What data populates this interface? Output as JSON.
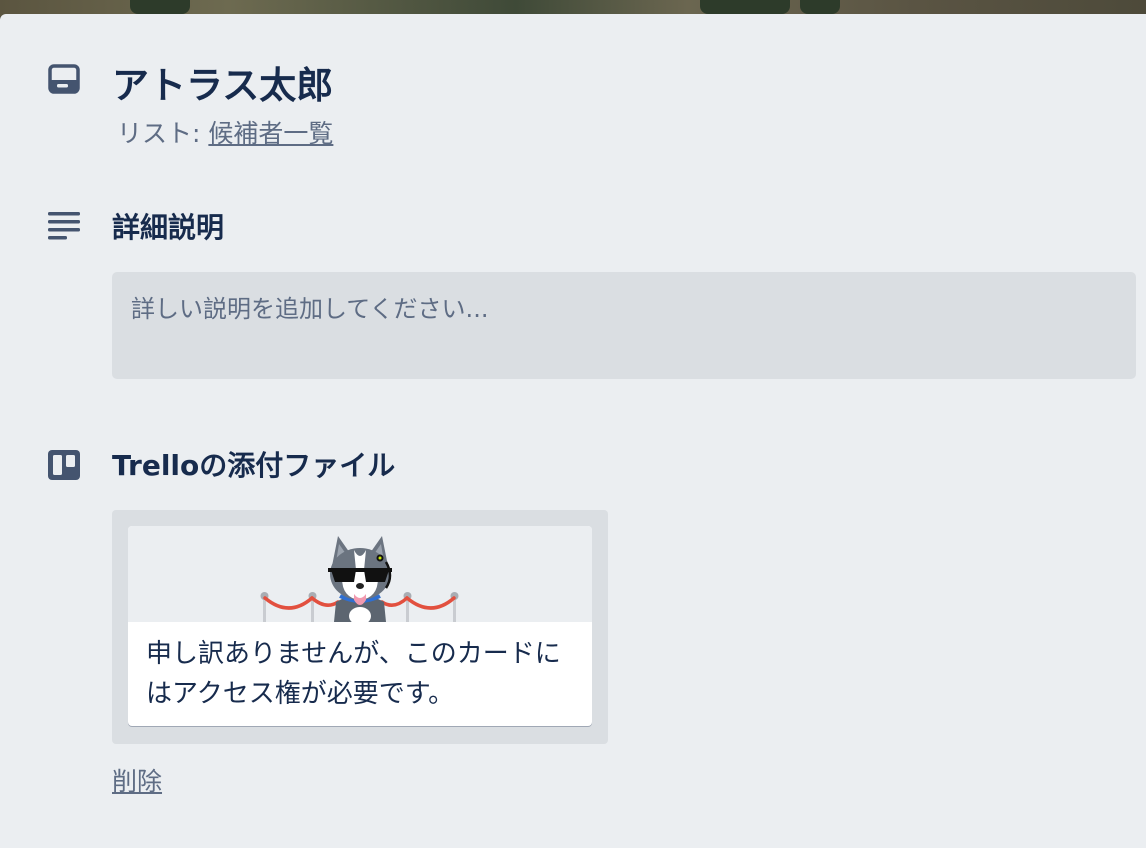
{
  "card": {
    "title": "アトラス太郎",
    "list_prefix": "リスト: ",
    "list_name": "候補者一覧"
  },
  "description": {
    "heading": "詳細説明",
    "placeholder": "詳しい説明を追加してください..."
  },
  "attachments": {
    "heading": "Trelloの添付ファイル",
    "card_message": "申し訳ありませんが、このカードにはアクセス権が必要です。",
    "delete_label": "削除"
  },
  "icons": {
    "card": "card-icon",
    "description": "description-lines-icon",
    "trello": "trello-board-icon",
    "mascot": "husky-mascot-with-sunglasses"
  },
  "colors": {
    "panel_bg": "#ebeef1",
    "box_bg": "#dadee2",
    "heading_text": "#172b4d",
    "muted_text": "#5e6c84",
    "icon": "#44546f",
    "rope": "#e2503f"
  }
}
